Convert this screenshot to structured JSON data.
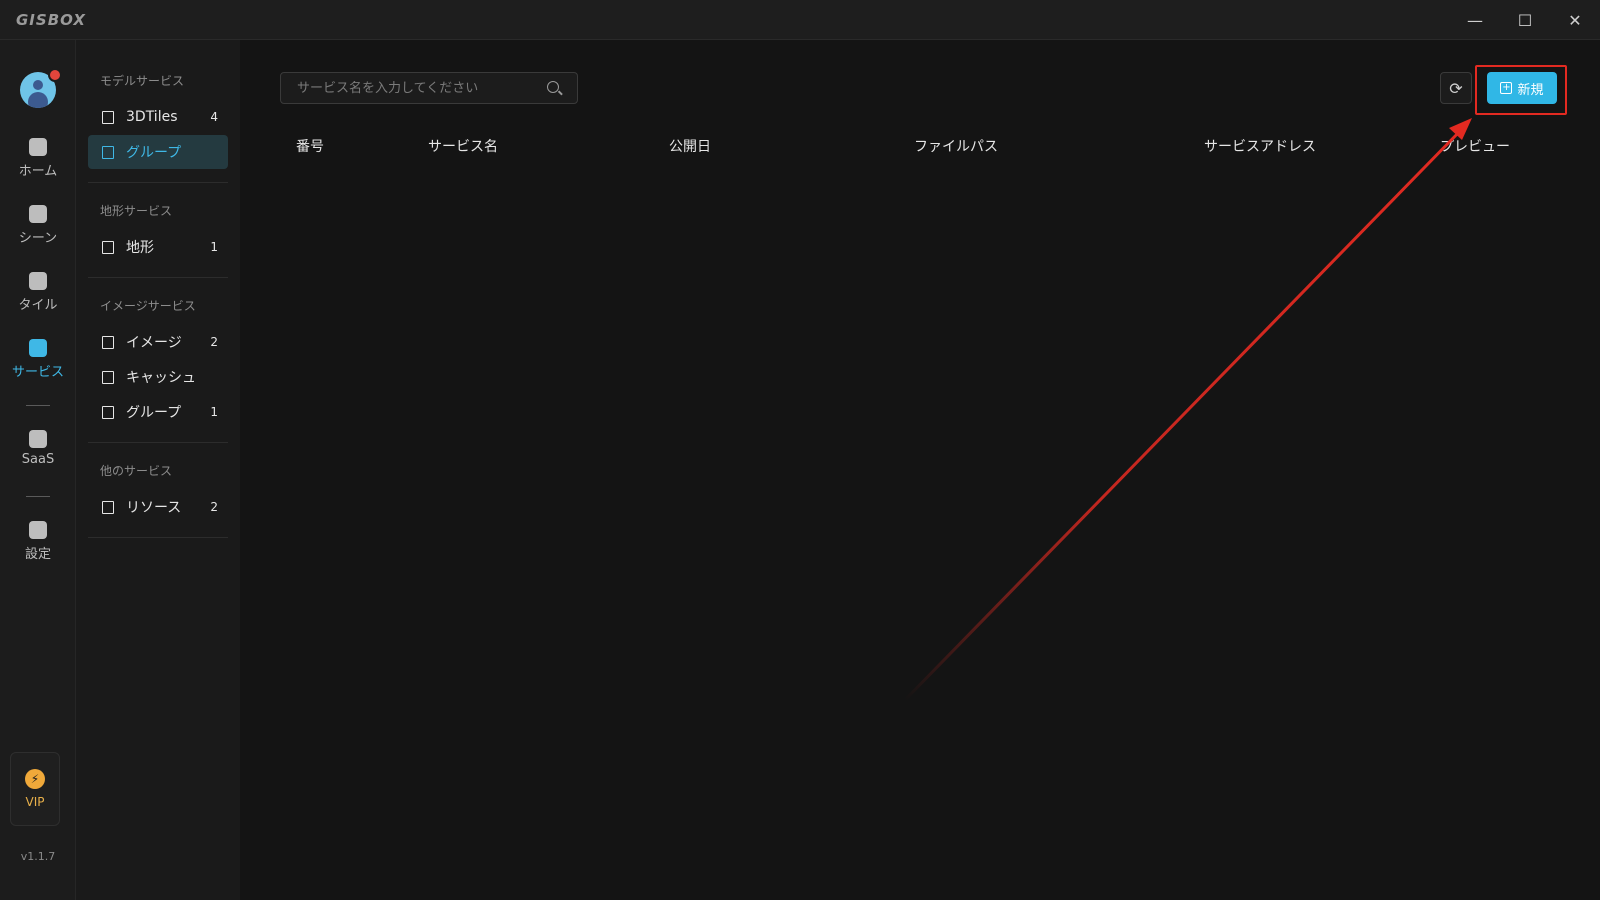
{
  "app": {
    "logo": "GISBOX"
  },
  "window_controls": {
    "minimize": "—",
    "maximize": "☐",
    "close": "✕"
  },
  "rail": {
    "items": [
      {
        "label": "ホーム"
      },
      {
        "label": "シーン"
      },
      {
        "label": "タイル"
      },
      {
        "label": "サービス"
      },
      {
        "label": "SaaS"
      },
      {
        "label": "設定"
      }
    ],
    "active": "サービス",
    "vip_label": "VIP",
    "version": "v1.1.7"
  },
  "sidebar": {
    "sections": [
      {
        "title": "モデルサービス",
        "items": [
          {
            "label": "3DTiles",
            "count": "4"
          },
          {
            "label": "グループ",
            "count": ""
          }
        ]
      },
      {
        "title": "地形サービス",
        "items": [
          {
            "label": "地形",
            "count": "1"
          }
        ]
      },
      {
        "title": "イメージサービス",
        "items": [
          {
            "label": "イメージ",
            "count": "2"
          },
          {
            "label": "キャッシュ",
            "count": ""
          },
          {
            "label": "グループ",
            "count": "1"
          }
        ]
      },
      {
        "title": "他のサービス",
        "items": [
          {
            "label": "リソース",
            "count": "2"
          }
        ]
      }
    ]
  },
  "main": {
    "search_placeholder": "サービス名を入力してください",
    "refresh_icon": "⟳",
    "new_button": "新規",
    "columns": [
      "番号",
      "サービス名",
      "公開日",
      "ファイルパス",
      "サービスアドレス",
      "プレビュー"
    ]
  },
  "colors": {
    "accent": "#30b7e6",
    "annotation": "#e32a21"
  }
}
